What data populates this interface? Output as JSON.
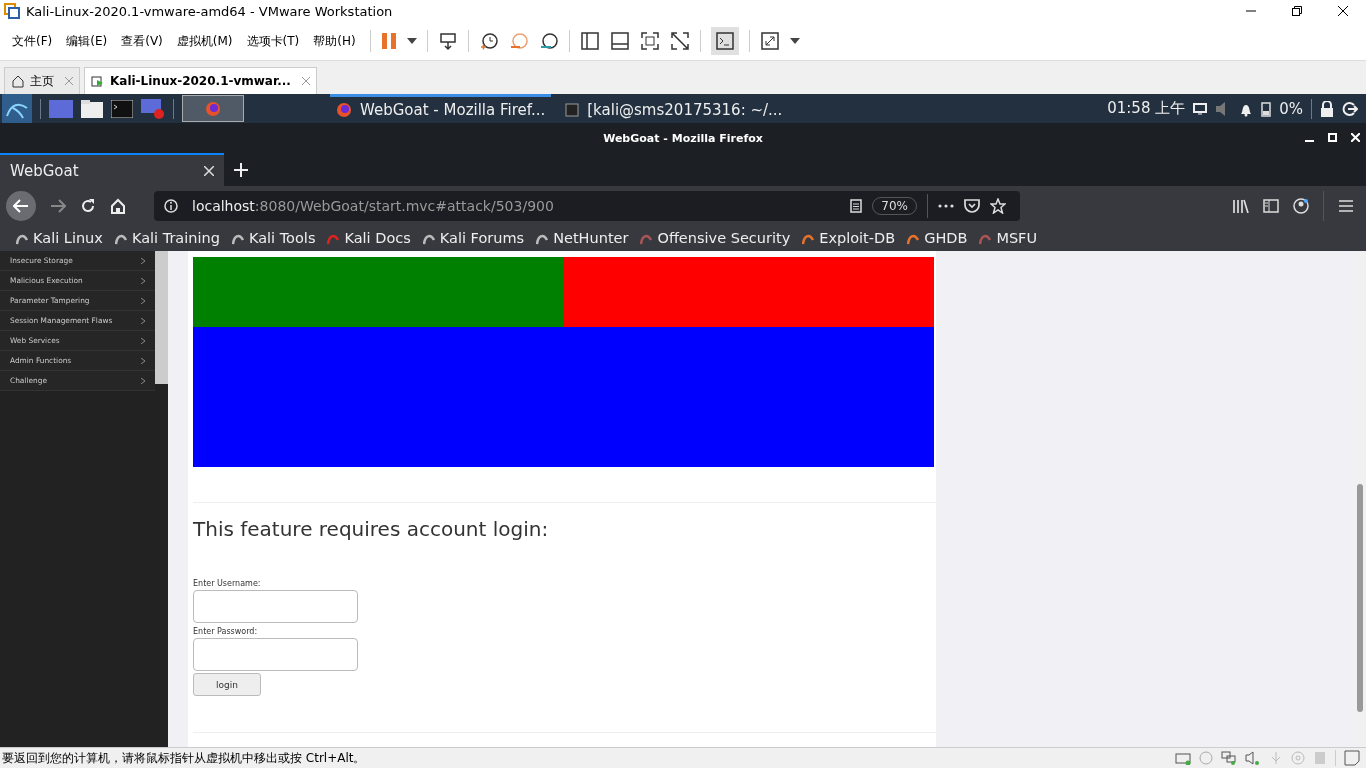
{
  "window": {
    "title": "Kali-Linux-2020.1-vmware-amd64 - VMware Workstation"
  },
  "menu": [
    "文件(F)",
    "编辑(E)",
    "查看(V)",
    "虚拟机(M)",
    "选项卡(T)",
    "帮助(H)"
  ],
  "vm_tabs": [
    {
      "label": "主页",
      "selected": false
    },
    {
      "label": "Kali-Linux-2020.1-vmwar...",
      "selected": true
    }
  ],
  "panel": {
    "tasks": [
      {
        "label": "WebGoat - Mozilla Firef...",
        "selected": true
      },
      {
        "label": "[kali@sms20175316: ~/...",
        "selected": false
      }
    ],
    "clock": "01:58 上午",
    "battery": "0%"
  },
  "browser": {
    "title": "WebGoat - Mozilla Firefox",
    "tabs": [
      {
        "label": "WebGoat",
        "selected": true
      }
    ],
    "url_host": "localhost",
    "url_rest": ":8080/WebGoat/start.mvc#attack/503/900",
    "zoom": "70%",
    "bookmarks": [
      "Kali Linux",
      "Kali Training",
      "Kali Tools",
      "Kali Docs",
      "Kali Forums",
      "NetHunter",
      "Offensive Security",
      "Exploit-DB",
      "GHDB",
      "MSFU"
    ]
  },
  "sidebar": {
    "items": [
      "Insecure Storage",
      "Malicious Execution",
      "Parameter Tampering",
      "Session Management Flaws",
      "Web Services",
      "Admin Functions",
      "Challenge"
    ]
  },
  "login": {
    "heading": "This feature requires account login:",
    "username_label": "Enter Username:",
    "password_label": "Enter Password:",
    "button": "login"
  },
  "status_bar": "要返回到您的计算机，请将鼠标指针从虚拟机中移出或按 Ctrl+Alt。"
}
